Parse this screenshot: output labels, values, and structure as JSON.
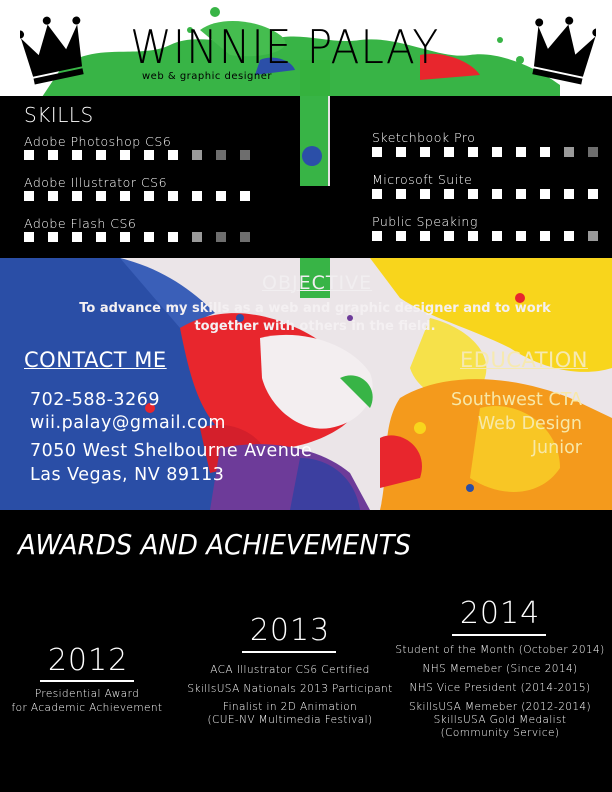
{
  "header": {
    "name": "WINNIE PALAY",
    "tagline": "web & graphic designer",
    "icons": [
      "crown-icon",
      "crown-icon"
    ],
    "colors": {
      "paint_green": "#35b23e",
      "paint_blue": "#2b4fa8",
      "paint_red": "#e8262d",
      "paint_yellow": "#f7d21a",
      "paint_orange": "#f39b1c"
    }
  },
  "skills": {
    "title": "SKILLS",
    "items": [
      {
        "name": "Adobe Photoshop CS6",
        "level": 7,
        "max": 10
      },
      {
        "name": "Adobe Illustrator CS6",
        "level": 10,
        "max": 10
      },
      {
        "name": "Adobe Flash CS6",
        "level": 7,
        "max": 10
      },
      {
        "name": "Sketchbook Pro",
        "level": 8,
        "max": 10
      },
      {
        "name": "Microsoft Suite",
        "level": 10,
        "max": 10
      },
      {
        "name": "Public Speaking",
        "level": 9,
        "max": 10
      }
    ]
  },
  "objective": {
    "title": "OBJECTIVE",
    "text": "To advance my skills as a web and graphic designer and to work together with others in the field."
  },
  "contact": {
    "title": "CONTACT ME",
    "phone": "702-588-3269",
    "email": "wii.palay@gmail.com",
    "street": "7050 West Shelbourne Avenue",
    "city": "Las Vegas, NV 89113"
  },
  "education": {
    "title": "EDUCATION",
    "school": "Southwest CTA",
    "program": "Web Design",
    "grade": "Junior"
  },
  "awards": {
    "title": "AWARDS AND ACHIEVEMENTS",
    "years": [
      {
        "year": "2012",
        "items": [
          "Presidential Award",
          "for Academic Achievement"
        ]
      },
      {
        "year": "2013",
        "items": [
          "ACA Illustrator CS6 Certified",
          "SkillsUSA Nationals 2013 Participant",
          "Finalist in 2D Animation",
          "(CUE-NV Multimedia Festival)"
        ]
      },
      {
        "year": "2014",
        "items": [
          "Student of the Month (October 2014)",
          "NHS Memeber (Since 2014)",
          "NHS Vice President (2014-2015)",
          "SkillsUSA Memeber (2012-2014)",
          "SkillsUSA Gold Medalist",
          "(Community Service)"
        ]
      }
    ]
  }
}
